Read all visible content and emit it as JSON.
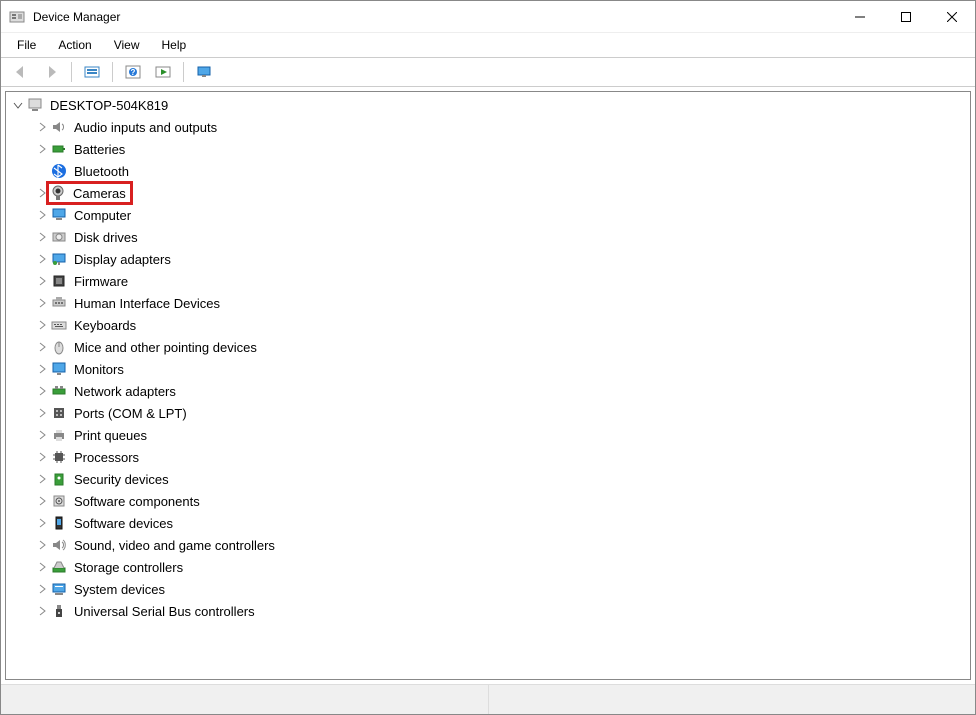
{
  "window": {
    "title": "Device Manager"
  },
  "menus": [
    "File",
    "Action",
    "View",
    "Help"
  ],
  "toolbar": {
    "back": "←",
    "forward": "→",
    "props": "props",
    "help": "help",
    "scan": "scan",
    "display": "display"
  },
  "computer_name": "DESKTOP-504K819",
  "highlighted_category": "Cameras",
  "categories": [
    {
      "label": "Audio inputs and outputs",
      "icon": "speaker-icon",
      "expandable": true
    },
    {
      "label": "Batteries",
      "icon": "battery-icon",
      "expandable": true
    },
    {
      "label": "Bluetooth",
      "icon": "bluetooth-icon",
      "expandable": false
    },
    {
      "label": "Cameras",
      "icon": "camera-icon",
      "expandable": true,
      "highlighted": true
    },
    {
      "label": "Computer",
      "icon": "computer-icon",
      "expandable": true
    },
    {
      "label": "Disk drives",
      "icon": "disk-icon",
      "expandable": true
    },
    {
      "label": "Display adapters",
      "icon": "display-icon",
      "expandable": true
    },
    {
      "label": "Firmware",
      "icon": "firmware-icon",
      "expandable": true
    },
    {
      "label": "Human Interface Devices",
      "icon": "hid-icon",
      "expandable": true
    },
    {
      "label": "Keyboards",
      "icon": "keyboard-icon",
      "expandable": true
    },
    {
      "label": "Mice and other pointing devices",
      "icon": "mouse-icon",
      "expandable": true
    },
    {
      "label": "Monitors",
      "icon": "monitor-icon",
      "expandable": true
    },
    {
      "label": "Network adapters",
      "icon": "network-icon",
      "expandable": true
    },
    {
      "label": "Ports (COM & LPT)",
      "icon": "port-icon",
      "expandable": true
    },
    {
      "label": "Print queues",
      "icon": "printer-icon",
      "expandable": true
    },
    {
      "label": "Processors",
      "icon": "processor-icon",
      "expandable": true
    },
    {
      "label": "Security devices",
      "icon": "security-icon",
      "expandable": true
    },
    {
      "label": "Software components",
      "icon": "software-icon",
      "expandable": true
    },
    {
      "label": "Software devices",
      "icon": "software-device-icon",
      "expandable": true
    },
    {
      "label": "Sound, video and game controllers",
      "icon": "sound-icon",
      "expandable": true
    },
    {
      "label": "Storage controllers",
      "icon": "storage-icon",
      "expandable": true
    },
    {
      "label": "System devices",
      "icon": "system-icon",
      "expandable": true
    },
    {
      "label": "Universal Serial Bus controllers",
      "icon": "usb-icon",
      "expandable": true
    }
  ]
}
